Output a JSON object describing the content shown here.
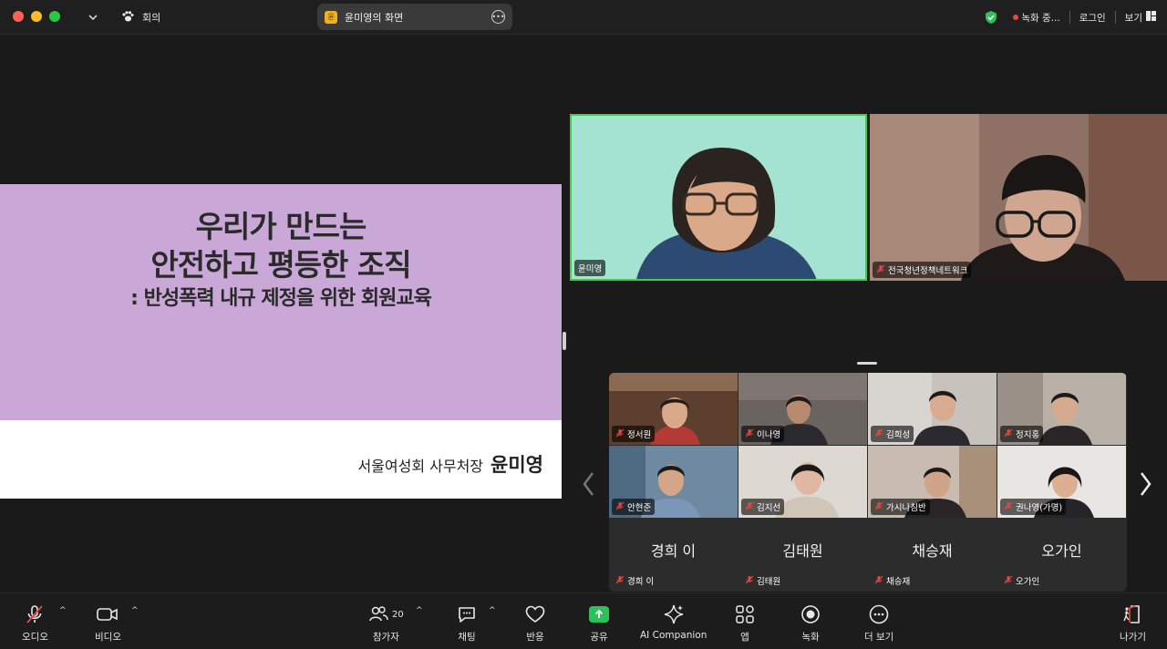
{
  "titlebar": {
    "meeting_label": "회의",
    "share_pill_label": "윤미영의 화면",
    "share_pill_badge": "윤",
    "recording_label": "녹화 중...",
    "login_label": "로그인",
    "view_label": "보기"
  },
  "slide": {
    "title_line_1": "우리가 만드는",
    "title_line_2": "안전하고 평등한 조직",
    "subtitle": ": 반성폭력 내규 제정을 위한 회원교육",
    "presenter_role": "서울여성회 사무처장",
    "presenter_name": "윤미영"
  },
  "speakers": [
    {
      "name": "윤미영",
      "muted": false,
      "active": true
    },
    {
      "name": "전국청년정책네트워크",
      "muted": true,
      "active": false
    }
  ],
  "gallery": [
    {
      "name": "정서원",
      "muted": true
    },
    {
      "name": "이나영",
      "muted": true
    },
    {
      "name": "김희성",
      "muted": true
    },
    {
      "name": "정지홍",
      "muted": true
    },
    {
      "name": "안현준",
      "muted": true
    },
    {
      "name": "김지선",
      "muted": true
    },
    {
      "name": "가시나침반",
      "muted": true
    },
    {
      "name": "권나영(가명)",
      "muted": true
    }
  ],
  "no_video": [
    {
      "display": "경희 이",
      "label": "경희 이"
    },
    {
      "display": "김태원",
      "label": "김태원"
    },
    {
      "display": "채승재",
      "label": "채승재"
    },
    {
      "display": "오가인",
      "label": "오가인"
    }
  ],
  "toolbar": {
    "audio": "오디오",
    "video": "비디오",
    "participants": "참가자",
    "participants_count": "20",
    "chat": "채팅",
    "reactions": "반응",
    "share": "공유",
    "ai_companion": "AI Companion",
    "apps": "앱",
    "record": "녹화",
    "more": "더 보기",
    "leave": "나가기"
  },
  "colors": {
    "active_speaker_border": "#3ecf4a",
    "recording_dot": "#e5483c",
    "share_green": "#2ec05a",
    "slide_band": "#c9a8d7",
    "muted_red": "#e5483c"
  }
}
